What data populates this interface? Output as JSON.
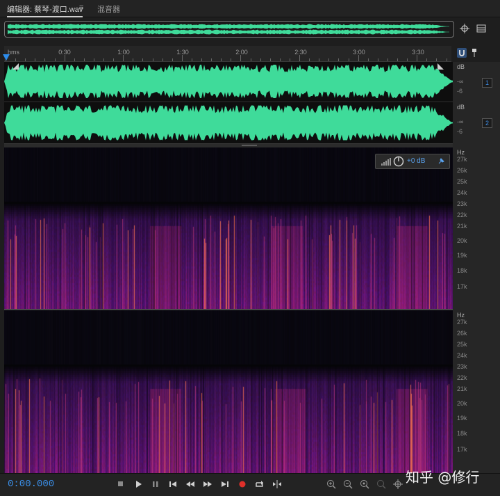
{
  "tabs": {
    "editor_label": "编辑器: 蔡琴-渡口.wav",
    "menu_icon": "≡",
    "mixer_label": "混音器"
  },
  "colors": {
    "waveform": "#3fdb9a",
    "accent": "#2d8ceb",
    "background": "#1e1e1e"
  },
  "ruler": {
    "unit": "hms",
    "labels": [
      "0:30",
      "1:00",
      "1:30",
      "2:00",
      "2:30",
      "3:00",
      "3:30"
    ]
  },
  "amplitude_scale": {
    "unit": "dB",
    "values": [
      "-∞",
      "-6"
    ]
  },
  "channels": {
    "ch1": "1",
    "ch2": "2"
  },
  "hud": {
    "gain": "+0 dB"
  },
  "frequency_scale": {
    "unit": "Hz",
    "labels": [
      "27k",
      "26k",
      "25k",
      "24k",
      "23k",
      "22k",
      "21k",
      "20k",
      "19k",
      "18k",
      "17k"
    ]
  },
  "transport": {
    "timecode": "0:00.000"
  },
  "watermark": "知乎 @修行",
  "icons": [
    "zoom-to-selection-icon",
    "fit-icon",
    "play-icon",
    "pause-icon",
    "stop-icon",
    "go-to-start-icon",
    "rewind-icon",
    "fast-forward-icon",
    "go-to-end-icon",
    "record-icon",
    "loop-icon",
    "skip-selection-icon",
    "zoom-in-amplitude-icon",
    "zoom-out-amplitude-icon",
    "zoom-in-icon",
    "zoom-out-icon",
    "zoom-full-icon",
    "magnet-icon",
    "pin-icon"
  ]
}
